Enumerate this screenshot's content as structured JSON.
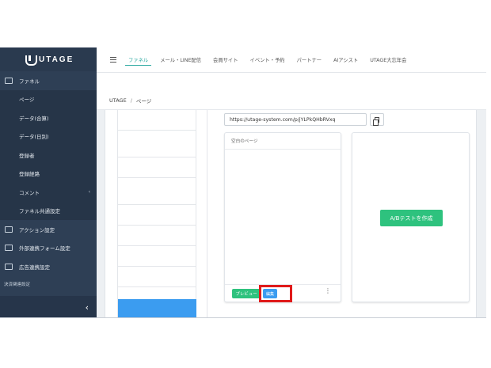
{
  "app": {
    "logo_text": "UTAGE"
  },
  "sidebar": {
    "items": [
      {
        "label": "ファネル",
        "type": "top",
        "icon": "funnel-icon"
      },
      {
        "label": "ページ",
        "type": "sub"
      },
      {
        "label": "データ(合算)",
        "type": "sub"
      },
      {
        "label": "データ(日別)",
        "type": "sub"
      },
      {
        "label": "登録者",
        "type": "sub"
      },
      {
        "label": "登録経路",
        "type": "sub"
      },
      {
        "label": "コメント",
        "type": "sub",
        "chevron": "‹"
      },
      {
        "label": "ファネル共通設定",
        "type": "sub"
      },
      {
        "label": "アクション設定",
        "type": "top",
        "icon": "action-icon"
      },
      {
        "label": "外部連携フォーム設定",
        "type": "top",
        "icon": "form-icon"
      },
      {
        "label": "広告連携設定",
        "type": "top",
        "icon": "megaphone-icon"
      }
    ],
    "section_label": "決済関連設定",
    "collapse_glyph": "‹"
  },
  "topnav": {
    "tabs": [
      {
        "label": "ファネル",
        "active": true
      },
      {
        "label": "メール・LINE配信"
      },
      {
        "label": "会員サイト"
      },
      {
        "label": "イベント・予約"
      },
      {
        "label": "パートナー"
      },
      {
        "label": "AIアシスト"
      },
      {
        "label": "UTAGE大忘年会"
      }
    ]
  },
  "breadcrumb": {
    "root": "UTAGE",
    "separator": "/",
    "current": "ページ"
  },
  "main": {
    "url": "https://utage-system.com/p/jYLPkQHbRVxq",
    "page_card": {
      "title": "空白のページ",
      "preview_label": "プレビュー",
      "edit_label": "編集",
      "more_glyph": "⋮"
    },
    "ab_card": {
      "button_label": "A/Bテストを作成"
    }
  },
  "colors": {
    "sidebar_bg": "#2e3f55",
    "accent_teal": "#2aa8a0",
    "green": "#2ec27e",
    "blue": "#3b9cf0",
    "highlight_red": "#e01a1a"
  }
}
